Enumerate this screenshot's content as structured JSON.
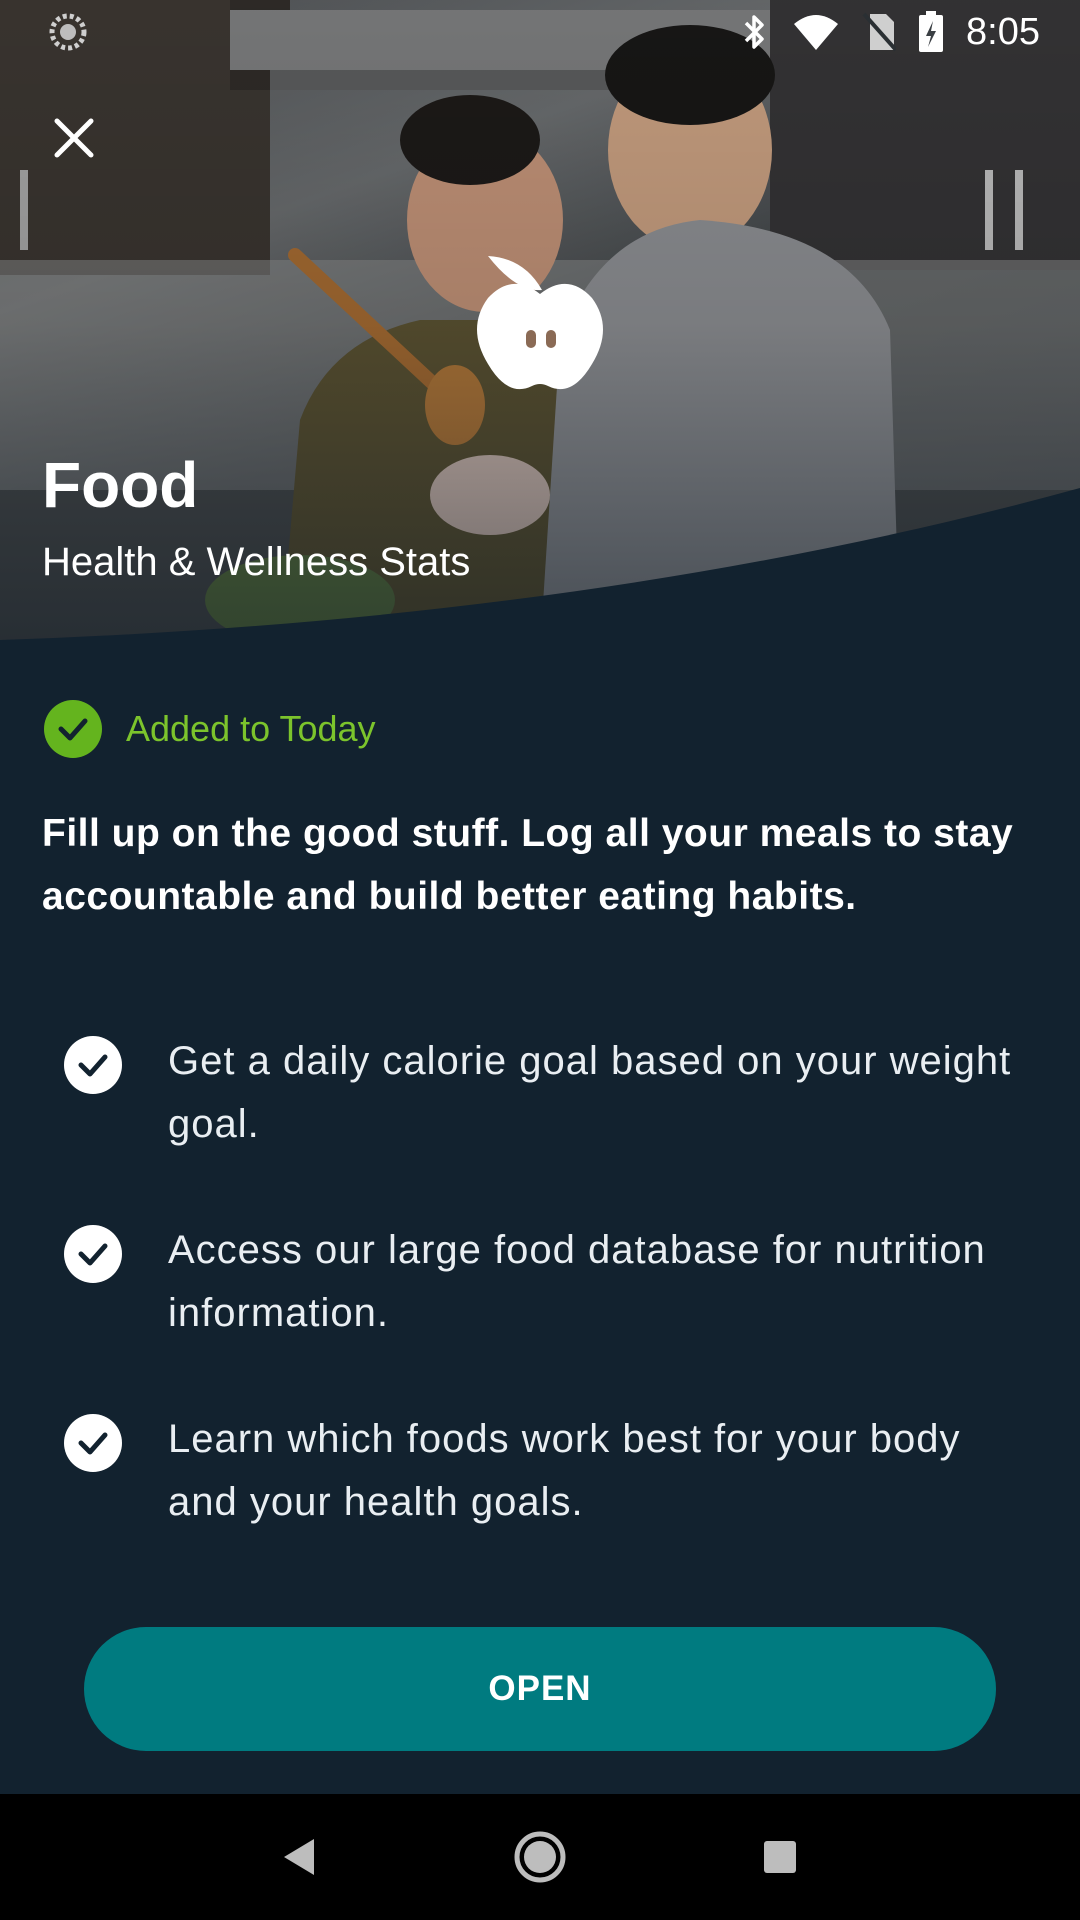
{
  "status_bar": {
    "time": "8:05",
    "icons": [
      "loading-spinner-icon",
      "bluetooth-icon",
      "wifi-icon",
      "no-sim-icon",
      "battery-icon"
    ]
  },
  "hero": {
    "title": "Food",
    "subtitle": "Health & Wellness Stats",
    "logo_icon": "apple-icon",
    "close_icon": "close-icon"
  },
  "status": {
    "label": "Added to Today",
    "icon": "check-circle-icon",
    "color": "#64b41e"
  },
  "headline": "Fill up on the good stuff. Log all your meals to stay accountable and build better eating habits.",
  "benefits": [
    {
      "text": "Get a daily calorie goal based on your weight goal."
    },
    {
      "text": "Access our large food database for nutrition information."
    },
    {
      "text": "Learn which foods work best for your body and your health goals."
    }
  ],
  "cta": {
    "label": "OPEN",
    "color": "#007b80"
  },
  "nav": {
    "icons": [
      "back-icon",
      "home-icon",
      "recents-icon"
    ]
  },
  "colors": {
    "background": "#12222f",
    "accent_green": "#7cc42c"
  }
}
